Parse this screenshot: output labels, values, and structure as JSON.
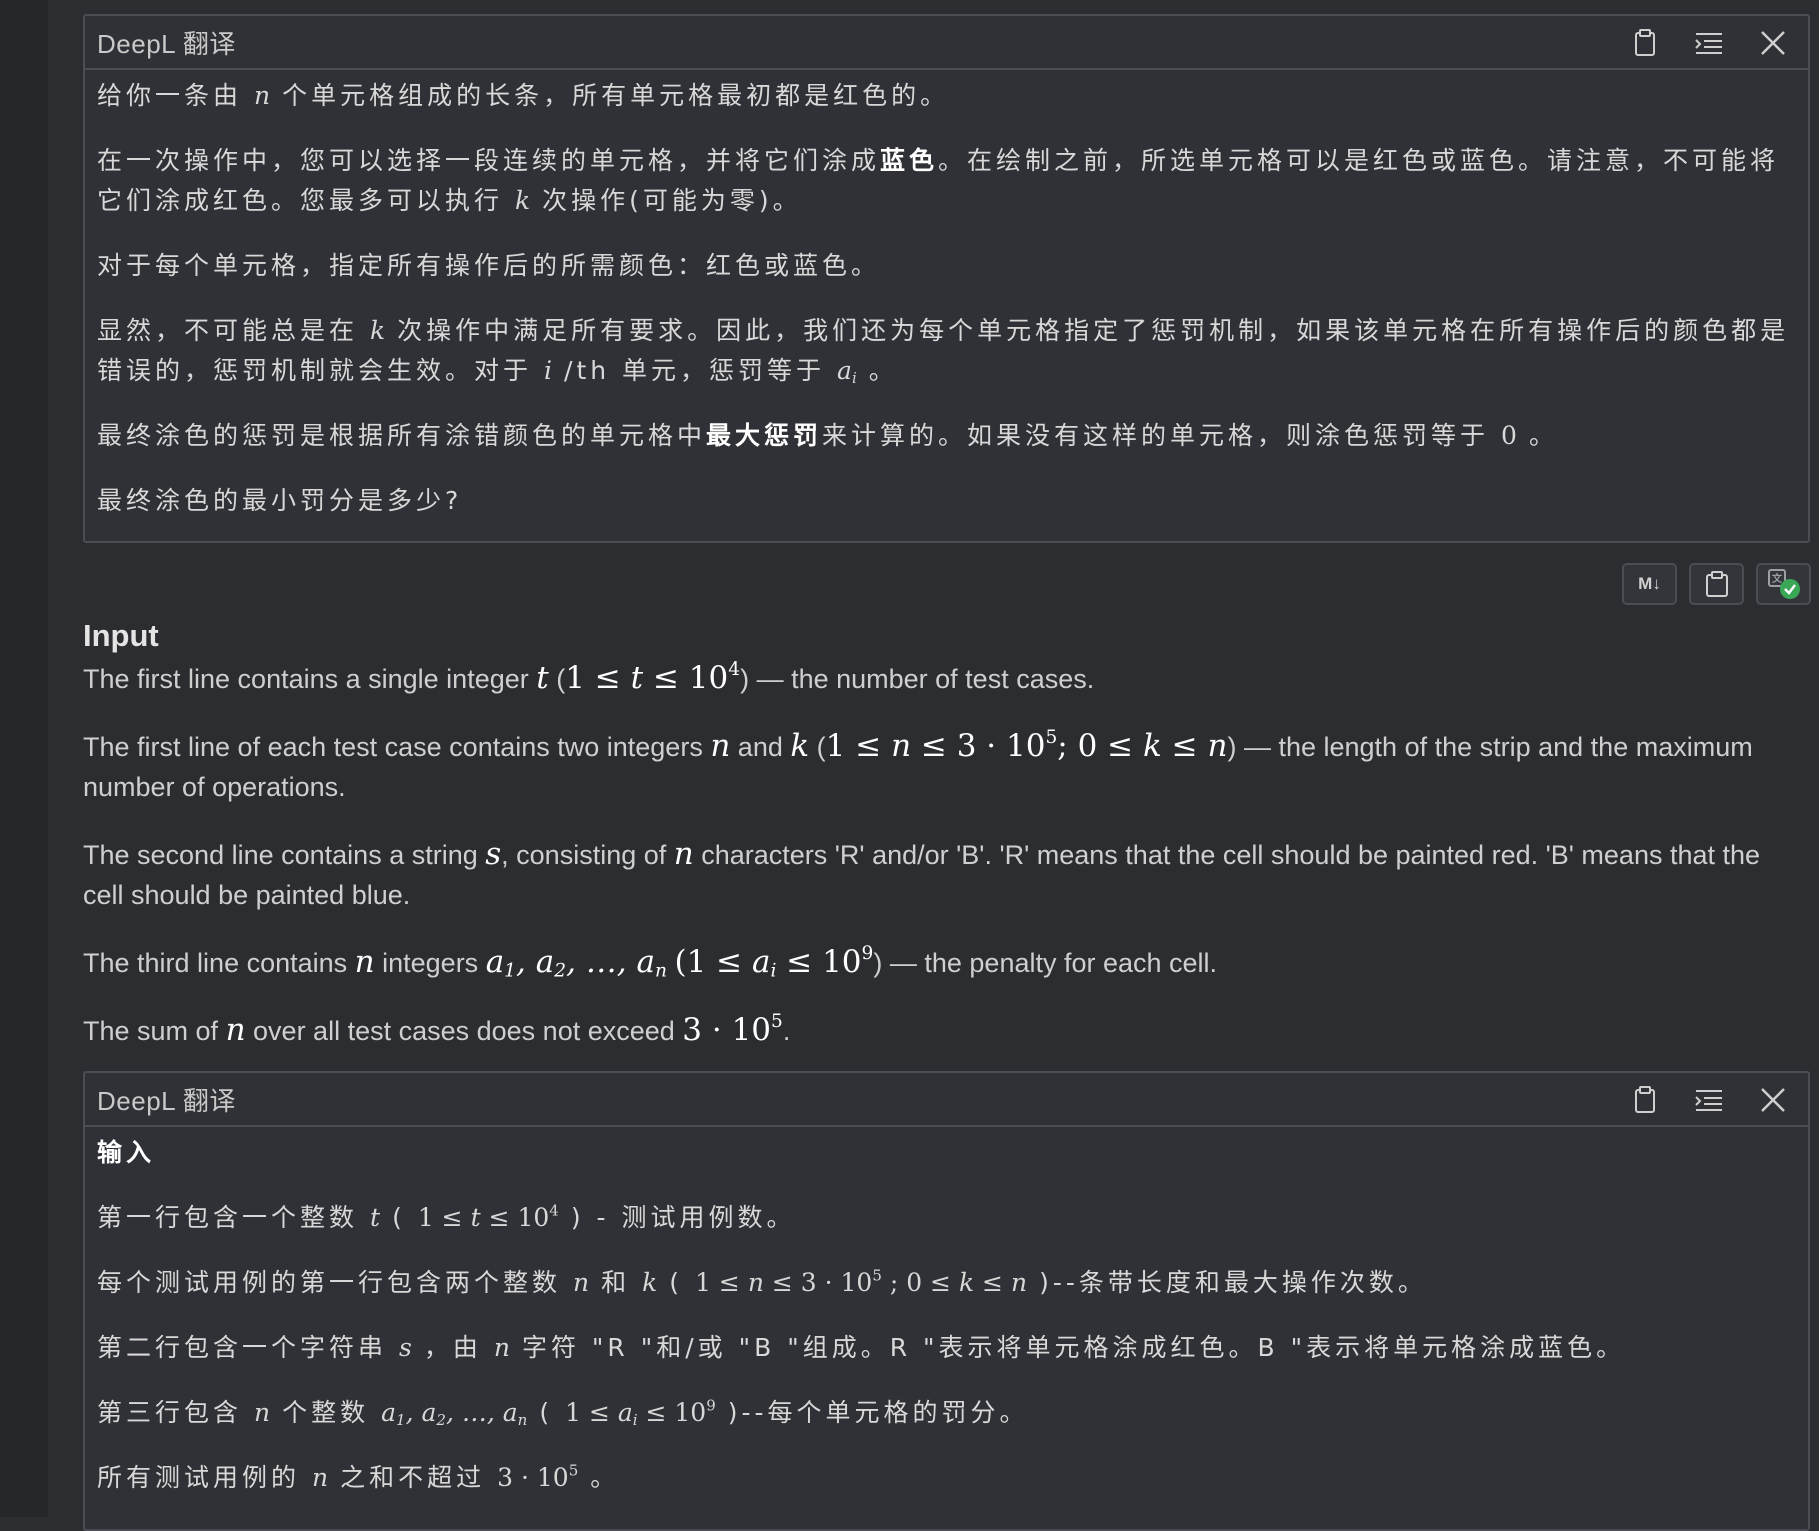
{
  "panel1": {
    "title": "DeepL 翻译",
    "p1a": "给你一条由",
    "p1m": "n",
    "p1b": "个单元格组成的长条，所有单元格最初都是红色的。",
    "p2a": "在一次操作中，您可以选择一段连续的单元格，并将它们涂成",
    "p2bold": "蓝色",
    "p2b": "。在绘制之前，所选单元格可以是红色或蓝色。请注意，不可能将它们涂成红色。您最多可以执行",
    "p2m": "k",
    "p2c": "次操作(可能为零)。",
    "p3": "对于每个单元格，指定所有操作后的所需颜色：红色或蓝色。",
    "p4a": "显然，不可能总是在",
    "p4m1": "k",
    "p4b": "次操作中满足所有要求。因此，我们还为每个单元格指定了惩罚机制，如果该单元格在所有操作后的颜色都是错误的，惩罚机制就会生效。对于",
    "p4m2": "i",
    "p4c": "/th 单元，惩罚等于",
    "p4m3": "a",
    "p4m3sub": "i",
    "p4d": "。",
    "p5a": "最终涂色的惩罚是根据所有涂错颜色的单元格中",
    "p5bold": "最大惩罚",
    "p5b": "来计算的。如果没有这样的单元格，则涂色惩罚等于",
    "p5m": "0",
    "p5c": "。",
    "p6": "最终涂色的最小罚分是多少?"
  },
  "toolbar": {
    "md_label": "M↓"
  },
  "input": {
    "title": "Input",
    "l1a": "The first line contains a single integer ",
    "l1t": "t",
    "l1b": " (",
    "l1m": "1 ≤ ",
    "l1t2": "t",
    "l1m2": " ≤ 10",
    "l1sup": "4",
    "l1c": ") — the number of test cases.",
    "l2a": "The first line of each test case contains two integers ",
    "l2n": "n",
    "l2b": " and ",
    "l2k": "k",
    "l2c": " (",
    "l2m1": "1 ≤ ",
    "l2n2": "n",
    "l2m2": " ≤ 3 · 10",
    "l2sup": "5",
    "l2m3": "; 0 ≤ ",
    "l2k2": "k",
    "l2m4": " ≤ ",
    "l2n3": "n",
    "l2d": ") — the length of the strip and the maximum number of operations.",
    "l3a": "The second line contains a string ",
    "l3s": "s",
    "l3b": ", consisting of ",
    "l3n": "n",
    "l3c": " characters 'R' and/or 'B'. 'R' means that the cell should be painted red. 'B' means that the cell should be painted blue.",
    "l4a": "The third line contains ",
    "l4n": "n",
    "l4b": " integers ",
    "l4seq": "a",
    "l4c": ") — the penalty for each cell.",
    "l5a": "The sum of ",
    "l5n": "n",
    "l5b": " over all test cases does not exceed ",
    "l5m": "3 · 10",
    "l5sup": "5",
    "l5c": "."
  },
  "panel2": {
    "title": "DeepL 翻译",
    "h": "输入",
    "q1a": "第一行包含一个整数",
    "q1m": "t",
    "q1b": "(",
    "q1c": ") - 测试用例数。",
    "q2a": "每个测试用例的第一行包含两个整数",
    "q2n": "n",
    "q2and": "和",
    "q2k": "k",
    "q2b": "(",
    "q2c": ")--条带长度和最大操作次数。",
    "q3a": "第二行包含一个字符串",
    "q3s": "s",
    "q3b": "，由",
    "q3n": "n",
    "q3c": "字符 \"R \"和/或 \"B \"组成。R \"表示将单元格涂成红色。B \"表示将单元格涂成蓝色。",
    "q4a": "第三行包含",
    "q4n": "n",
    "q4b": "个整数",
    "q4c": "(",
    "q4d": ")--每个单元格的罚分。",
    "q5a": "所有测试用例的",
    "q5n": "n",
    "q5b": "之和不超过",
    "q5c": "。"
  }
}
